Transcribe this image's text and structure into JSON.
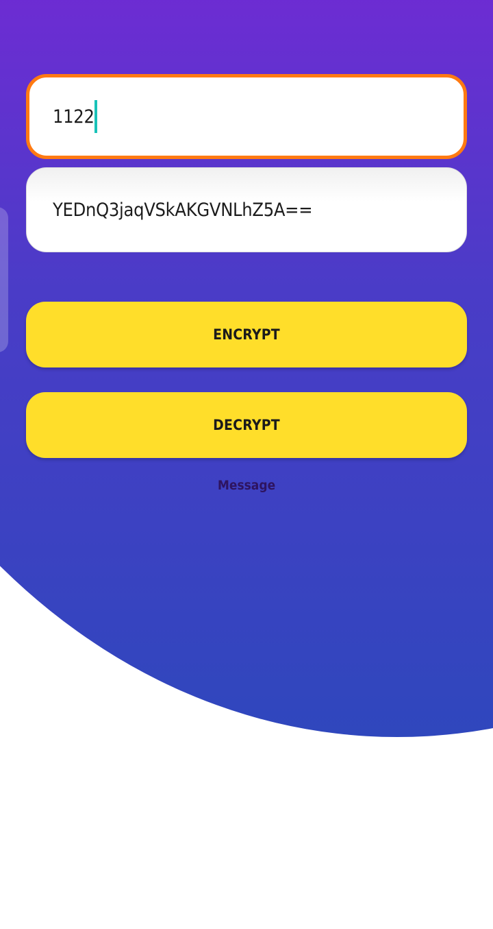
{
  "key_input": {
    "value": "1122"
  },
  "output_field": {
    "value": "YEDnQ3jaqVSkAKGVNLhZ5A=="
  },
  "buttons": {
    "encrypt_label": "ENCRYPT",
    "decrypt_label": "DECRYPT"
  },
  "message": {
    "text": "Message"
  },
  "colors": {
    "gradient_top": "#b312ec",
    "gradient_bottom": "#2f47bd",
    "button": "#ffde2a",
    "focus_border": "#ff7a12",
    "caret": "#19c2b8"
  }
}
